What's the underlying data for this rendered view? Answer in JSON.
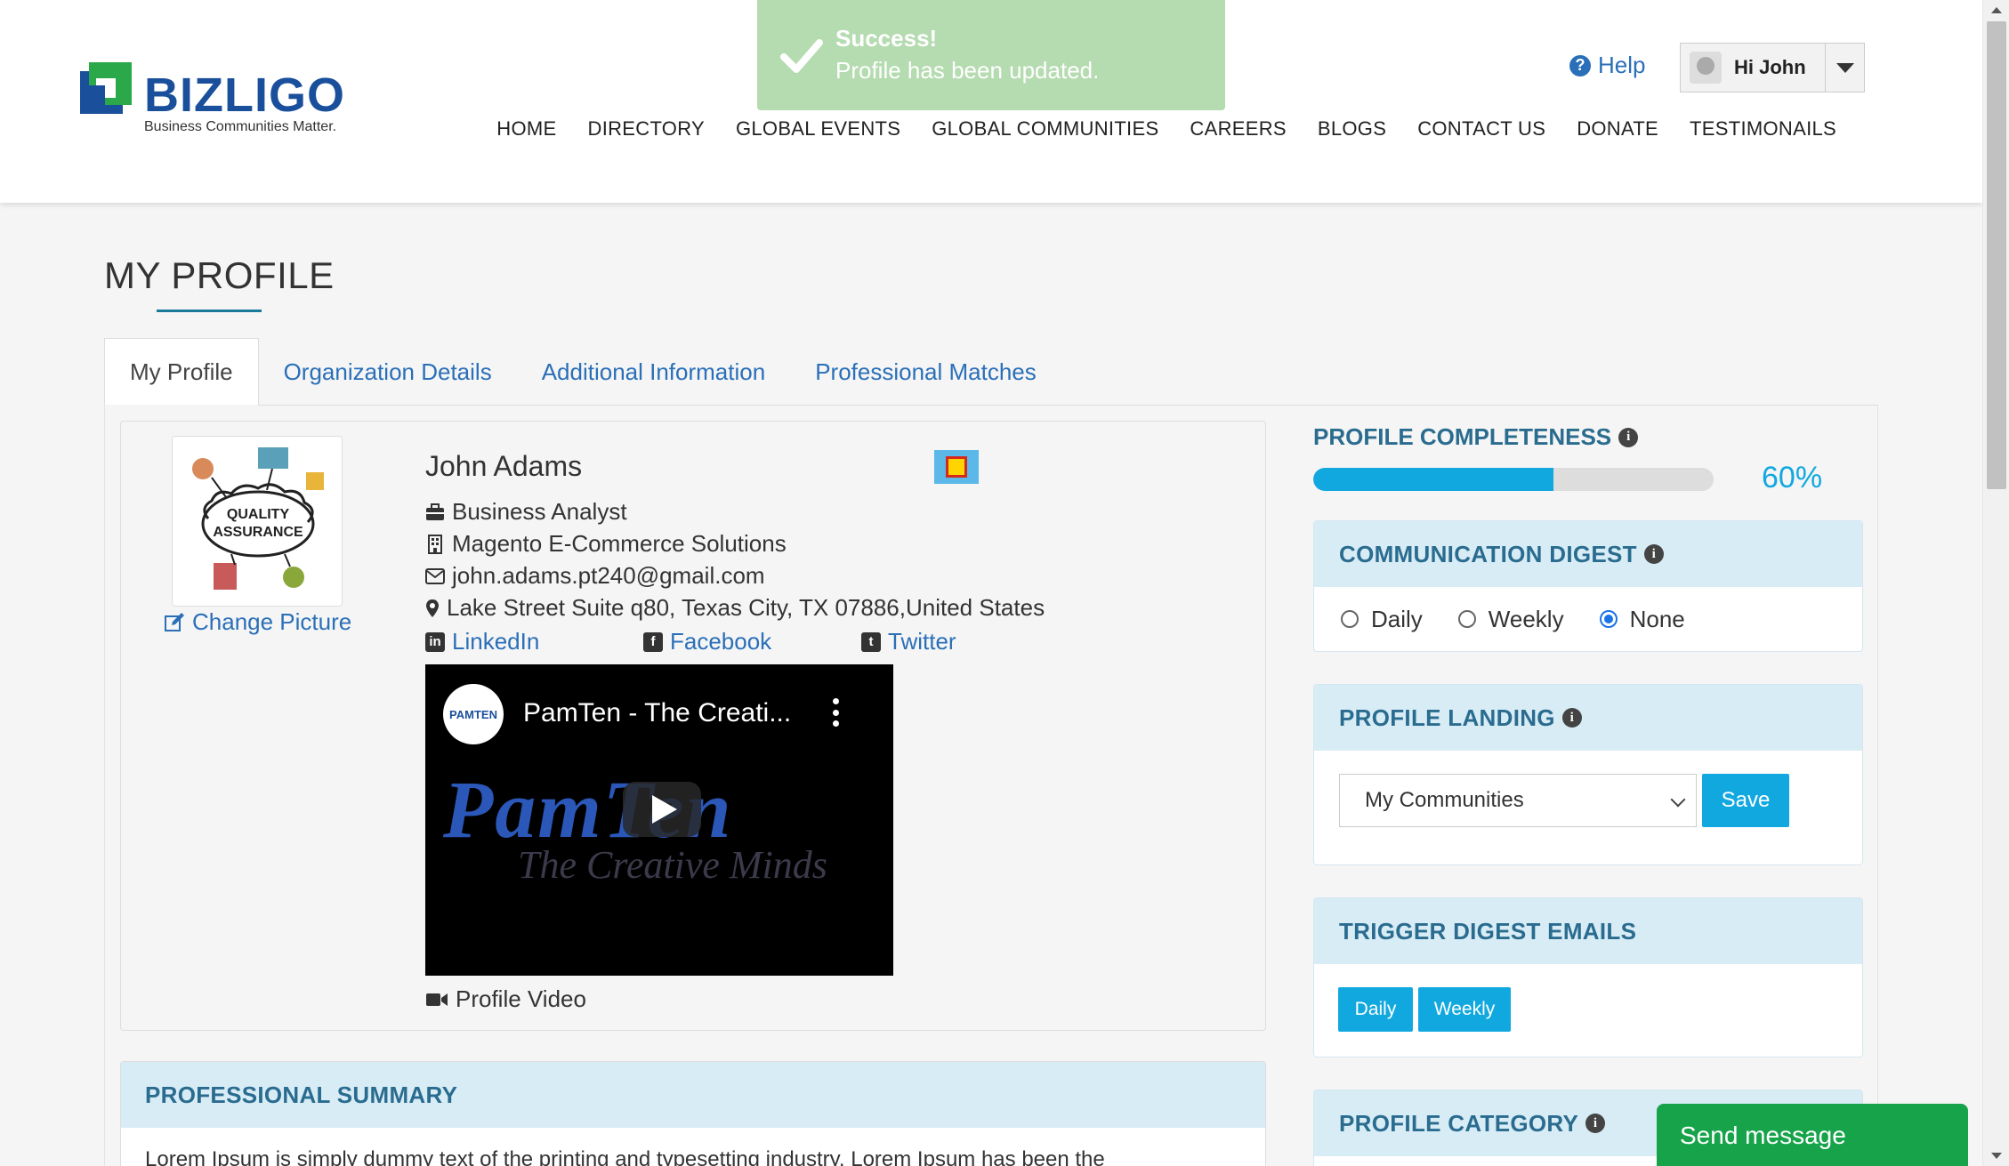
{
  "header": {
    "logo_word": "BIZLIGO",
    "logo_tag": "Business Communities Matter.",
    "help": "Help",
    "user_greeting": "Hi John",
    "nav": [
      "HOME",
      "DIRECTORY",
      "GLOBAL EVENTS",
      "GLOBAL COMMUNITIES",
      "CAREERS",
      "BLOGS",
      "CONTACT US",
      "DONATE",
      "TESTIMONAILS"
    ]
  },
  "toast": {
    "title": "Success!",
    "message": "Profile has been updated."
  },
  "page": {
    "title": "MY PROFILE"
  },
  "tabs": [
    "My Profile",
    "Organization Details",
    "Additional Information",
    "Professional Matches"
  ],
  "profile": {
    "avatar_text": "QUALITY ASSURANCE",
    "change_picture": "Change Picture",
    "name": "John Adams",
    "title": "Business Analyst",
    "company": "Magento E-Commerce Solutions",
    "email": "john.adams.pt240@gmail.com",
    "address": "Lake Street Suite q80, Texas City, TX 07886,United States",
    "linkedin": "LinkedIn",
    "facebook": "Facebook",
    "twitter": "Twitter",
    "video_channel": "PAMTEN",
    "video_title": "PamTen - The Creati...",
    "video_brand": "PamTen",
    "video_sub": "The Creative Minds",
    "video_caption": "Profile Video"
  },
  "summary": {
    "heading": "PROFESSIONAL SUMMARY",
    "text": "Lorem Ipsum is simply dummy text of the printing and typesetting industry. Lorem Ipsum has been the"
  },
  "completeness": {
    "label": "PROFILE COMPLETENESS",
    "percent_label": "60%",
    "percent": 60
  },
  "digest": {
    "label": "COMMUNICATION DIGEST",
    "options": [
      "Daily",
      "Weekly",
      "None"
    ],
    "selected": "None"
  },
  "landing": {
    "label": "PROFILE LANDING",
    "selected": "My Communities",
    "save": "Save"
  },
  "trigger": {
    "label": "TRIGGER DIGEST EMAILS",
    "daily": "Daily",
    "weekly": "Weekly"
  },
  "category": {
    "label": "PROFILE CATEGORY"
  },
  "chat": {
    "label": "Send message"
  },
  "colors": {
    "accent": "#11a8e0",
    "brand": "#1a4f9c",
    "panel_head": "#d8ecf6",
    "chat": "#17a34a",
    "toast": "#b5dbb0"
  }
}
